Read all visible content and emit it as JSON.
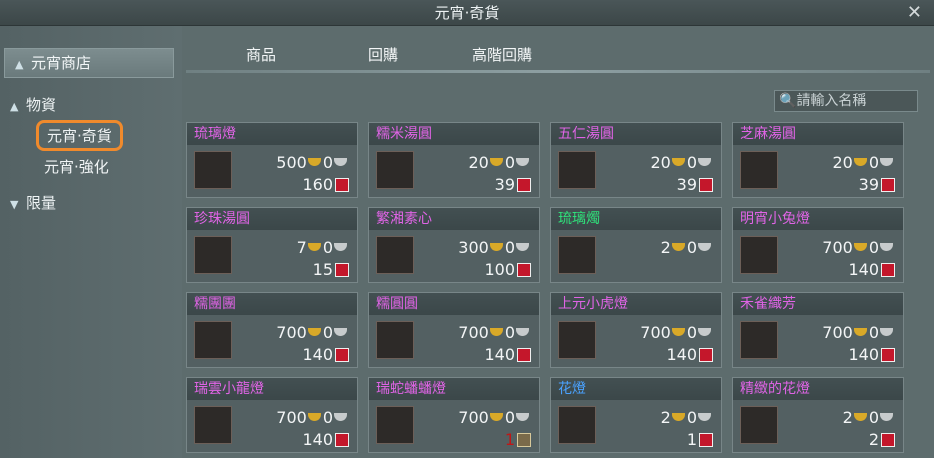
{
  "window": {
    "title": "元宵·奇貨",
    "close_icon": "✕"
  },
  "sidebar": {
    "shop_label": "元宵商店",
    "categories": [
      {
        "label": "物資",
        "caret": "▲"
      },
      {
        "label": "限量",
        "caret": "▼"
      }
    ],
    "subitems": [
      "元宵·奇貨",
      "元宵·強化"
    ]
  },
  "tabs": [
    "商品",
    "回購",
    "高階回購"
  ],
  "search": {
    "placeholder": "請輸入名稱"
  },
  "colors": {
    "purple": "#e064e6",
    "green": "#2fe07a",
    "blue": "#4aa2ff"
  },
  "items": [
    {
      "name": "琉璃燈",
      "price": "500",
      "silver": "0",
      "tokens": "160",
      "color": "#e064e6"
    },
    {
      "name": "糯米湯圓",
      "price": "20",
      "silver": "0",
      "tokens": "39",
      "color": "#e064e6"
    },
    {
      "name": "五仁湯圓",
      "price": "20",
      "silver": "0",
      "tokens": "39",
      "color": "#e064e6"
    },
    {
      "name": "芝麻湯圓",
      "price": "20",
      "silver": "0",
      "tokens": "39",
      "color": "#e064e6"
    },
    {
      "name": "珍珠湯圓",
      "price": "7",
      "silver": "0",
      "tokens": "15",
      "color": "#e064e6"
    },
    {
      "name": "繁湘素心",
      "price": "300",
      "silver": "0",
      "tokens": "100",
      "color": "#e064e6"
    },
    {
      "name": "琉璃燭",
      "price": "2",
      "silver": "0",
      "tokens": "",
      "color": "#2fe07a"
    },
    {
      "name": "明宵小兔燈",
      "price": "700",
      "silver": "0",
      "tokens": "140",
      "color": "#e064e6"
    },
    {
      "name": "糯團團",
      "price": "700",
      "silver": "0",
      "tokens": "140",
      "color": "#e064e6"
    },
    {
      "name": "糯圓圓",
      "price": "700",
      "silver": "0",
      "tokens": "140",
      "color": "#e064e6"
    },
    {
      "name": "上元小虎燈",
      "price": "700",
      "silver": "0",
      "tokens": "140",
      "color": "#e064e6"
    },
    {
      "name": "禾雀織芳",
      "price": "700",
      "silver": "0",
      "tokens": "140",
      "color": "#e064e6"
    },
    {
      "name": "瑞雲小龍燈",
      "price": "700",
      "silver": "0",
      "tokens": "140",
      "color": "#e064e6"
    },
    {
      "name": "瑞蛇蟠蟠燈",
      "price": "700",
      "silver": "0",
      "tokens": "1",
      "color": "#e064e6",
      "token_type": "book"
    },
    {
      "name": "花燈",
      "price": "2",
      "silver": "0",
      "tokens": "1",
      "color": "#4aa2ff"
    },
    {
      "name": "精緻的花燈",
      "price": "2",
      "silver": "0",
      "tokens": "2",
      "color": "#e064e6"
    }
  ]
}
